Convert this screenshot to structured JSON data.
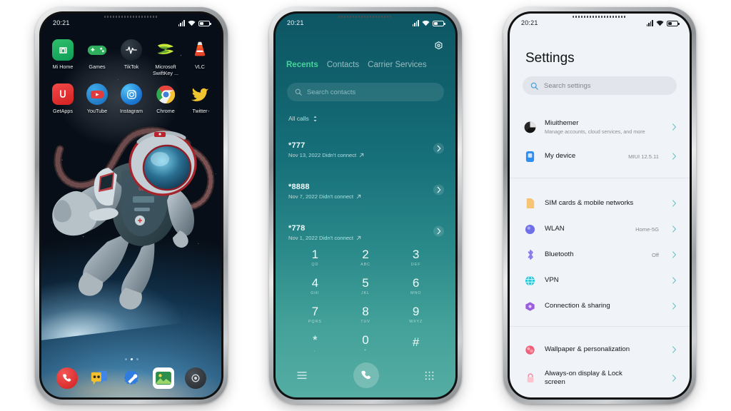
{
  "statusbar": {
    "time": "20:21",
    "signal_icon": "signal-icon",
    "wifi_icon": "wifi-icon",
    "battery_icon": "battery-icon"
  },
  "phone_home": {
    "name": "home-screen",
    "wallpaper_description": "astronaut-in-space-wallpaper",
    "apps": [
      {
        "label": "Mi Home",
        "icon": "mi-home-icon"
      },
      {
        "label": "Games",
        "icon": "games-controller-icon"
      },
      {
        "label": "TikTok",
        "icon": "tiktok-icon"
      },
      {
        "label": "Microsoft SwiftKey ...",
        "icon": "swiftkey-icon"
      },
      {
        "label": "VLC",
        "icon": "vlc-cone-icon"
      },
      {
        "label": "GetApps",
        "icon": "getapps-icon"
      },
      {
        "label": "YouTube",
        "icon": "youtube-icon"
      },
      {
        "label": "Instagram",
        "icon": "instagram-icon"
      },
      {
        "label": "Chrome",
        "icon": "chrome-icon"
      },
      {
        "label": "Twitter",
        "icon": "twitter-bird-icon"
      }
    ],
    "page_dots": {
      "count": 3,
      "active_index": 1
    },
    "dock": [
      {
        "label": "Phone",
        "icon": "phone-handset-icon"
      },
      {
        "label": "Messages",
        "icon": "messages-icon"
      },
      {
        "label": "Settings",
        "icon": "wrench-gear-icon"
      },
      {
        "label": "Gallery",
        "icon": "gallery-photo-icon"
      },
      {
        "label": "Camera",
        "icon": "camera-icon"
      }
    ]
  },
  "phone_dialer": {
    "name": "dialer-app",
    "settings_icon": "gear-icon",
    "tabs": [
      {
        "label": "Recents",
        "active": true
      },
      {
        "label": "Contacts",
        "active": false
      },
      {
        "label": "Carrier Services",
        "active": false
      }
    ],
    "search": {
      "placeholder": "Search contacts",
      "icon": "search-icon"
    },
    "filter": {
      "label": "All calls",
      "icon": "sort-updown-icon"
    },
    "calls": [
      {
        "number": "*777",
        "detail": "Nov 13, 2022 Didn't connect",
        "direction_icon": "outgoing-arrow-icon"
      },
      {
        "number": "*8888",
        "detail": "Nov 7, 2022 Didn't connect",
        "direction_icon": "outgoing-arrow-icon"
      },
      {
        "number": "*778",
        "detail": "Nov 1, 2022 Didn't connect",
        "direction_icon": "outgoing-arrow-icon"
      }
    ],
    "keypad": [
      {
        "digit": "1",
        "letters": "QD"
      },
      {
        "digit": "2",
        "letters": "ABC"
      },
      {
        "digit": "3",
        "letters": "DEF"
      },
      {
        "digit": "4",
        "letters": "GHI"
      },
      {
        "digit": "5",
        "letters": "JKL"
      },
      {
        "digit": "6",
        "letters": "MNO"
      },
      {
        "digit": "7",
        "letters": "PQRS"
      },
      {
        "digit": "8",
        "letters": "TUV"
      },
      {
        "digit": "9",
        "letters": "WXYZ"
      },
      {
        "digit": "*",
        "letters": ","
      },
      {
        "digit": "0",
        "letters": "+"
      },
      {
        "digit": "#",
        "letters": ""
      }
    ],
    "bottom_bar": {
      "menu_icon": "menu-lines-icon",
      "call_icon": "call-handset-icon",
      "dialpad_icon": "dialpad-grid-icon"
    },
    "accent_color": "#46d39a"
  },
  "phone_settings": {
    "name": "settings-app",
    "title": "Settings",
    "search": {
      "placeholder": "Search settings",
      "icon": "search-icon"
    },
    "groups": [
      {
        "rows": [
          {
            "label": "Miuithemer",
            "sub": "Manage accounts, cloud services, and more",
            "value": "",
            "icon": "account-avatar-icon",
            "color": "#141414"
          },
          {
            "label": "My device",
            "sub": "",
            "value": "MIUI 12.5.11",
            "icon": "device-icon",
            "color": "#2f8ef4"
          }
        ]
      },
      {
        "rows": [
          {
            "label": "SIM cards & mobile networks",
            "sub": "",
            "value": "",
            "icon": "sim-card-icon",
            "color": "#f4b860"
          },
          {
            "label": "WLAN",
            "sub": "",
            "value": "Home-5G",
            "icon": "wifi-circle-icon",
            "color": "#6f6fe8"
          },
          {
            "label": "Bluetooth",
            "sub": "",
            "value": "Off",
            "icon": "bluetooth-icon",
            "color": "#8b7aea"
          },
          {
            "label": "VPN",
            "sub": "",
            "value": "",
            "icon": "vpn-globe-icon",
            "color": "#27c6d9"
          },
          {
            "label": "Connection & sharing",
            "sub": "",
            "value": "",
            "icon": "connection-sharing-icon",
            "color": "#9b5ede"
          }
        ]
      },
      {
        "rows": [
          {
            "label": "Wallpaper & personalization",
            "sub": "",
            "value": "",
            "icon": "wallpaper-icon",
            "color": "#ef5f7a"
          },
          {
            "label": "Always-on display & Lock screen",
            "sub": "",
            "value": "",
            "icon": "lock-icon",
            "color": "#f2869a"
          }
        ]
      }
    ]
  }
}
